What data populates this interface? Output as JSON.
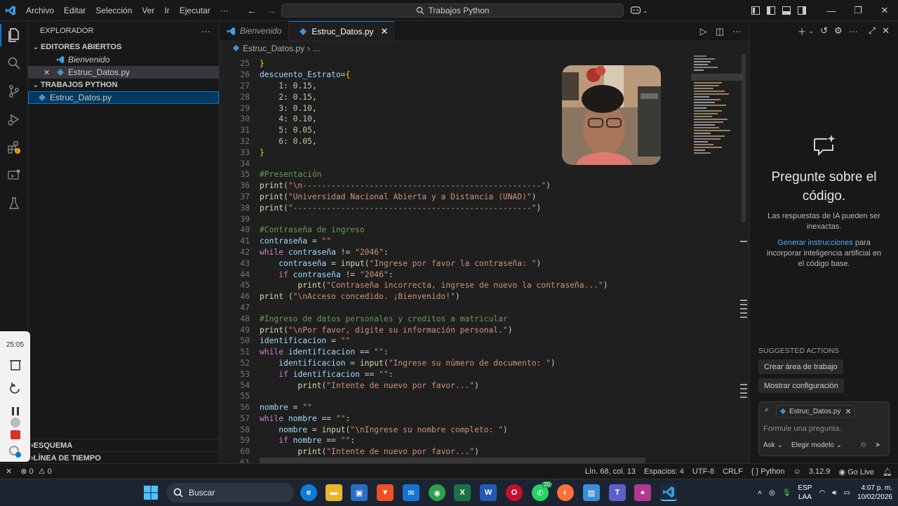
{
  "menu": [
    "Archivo",
    "Editar",
    "Selección",
    "Ver",
    "Ir",
    "Ejecutar",
    "···"
  ],
  "command_center": "Trabajos Python",
  "explorer": {
    "title": "EXPLORADOR",
    "open_editors_label": "EDITORES ABIERTOS",
    "open_editors": [
      "Bienvenido",
      "Estruc_Datos.py"
    ],
    "folder_label": "TRABAJOS PYTHON",
    "files": [
      "Estruc_Datos.py"
    ],
    "outline_label": "ESQUEMA",
    "timeline_label": "LÍNEA DE TIEMPO"
  },
  "tabs": [
    {
      "label": "Bienvenido",
      "active": false
    },
    {
      "label": "Estruc_Datos.py",
      "active": true
    }
  ],
  "breadcrumb": {
    "file": "Estruc_Datos.py",
    "rest": "..."
  },
  "code_lines": [
    {
      "n": "25",
      "html": "<span class=\"br\">}</span>"
    },
    {
      "n": "26",
      "html": "<span class=\"vr\">descuento_Estrato</span>=<span class=\"br\">{</span>"
    },
    {
      "n": "27",
      "html": "    <span class=\"nu\">1</span>: <span class=\"nu\">0.15</span>,"
    },
    {
      "n": "28",
      "html": "    <span class=\"nu\">2</span>: <span class=\"nu\">0.15</span>,"
    },
    {
      "n": "29",
      "html": "    <span class=\"nu\">3</span>: <span class=\"nu\">0.10</span>,"
    },
    {
      "n": "30",
      "html": "    <span class=\"nu\">4</span>: <span class=\"nu\">0.10</span>,"
    },
    {
      "n": "31",
      "html": "    <span class=\"nu\">5</span>: <span class=\"nu\">0.05</span>,"
    },
    {
      "n": "32",
      "html": "    <span class=\"nu\">6</span>: <span class=\"nu\">0.05</span>,"
    },
    {
      "n": "33",
      "html": "<span class=\"br\">}</span>"
    },
    {
      "n": "34",
      "html": ""
    },
    {
      "n": "35",
      "html": "<span class=\"cm\">#Presentación</span>"
    },
    {
      "n": "36",
      "html": "<span class=\"fn\">print</span>(<span class=\"st\">\"\\n--------------------------------------------------\"</span>)"
    },
    {
      "n": "37",
      "html": "<span class=\"fn\">print</span>(<span class=\"st\">\"Universidad Nacional Abierta y a Distancia (UNAD)\"</span>)"
    },
    {
      "n": "38",
      "html": "<span class=\"fn\">print</span>(<span class=\"st\">\"--------------------------------------------------\"</span>)"
    },
    {
      "n": "39",
      "html": ""
    },
    {
      "n": "40",
      "html": "<span class=\"cm\">#Contraseña de ingreso</span>"
    },
    {
      "n": "41",
      "html": "<span class=\"vr\">contraseña</span> = <span class=\"st\">\"\"</span>"
    },
    {
      "n": "42",
      "html": "<span class=\"kw\">while</span> <span class=\"vr\">contraseña</span> != <span class=\"st\">\"2046\"</span>:"
    },
    {
      "n": "43",
      "html": "    <span class=\"vr\">contraseña</span> = <span class=\"fn\">input</span>(<span class=\"st\">\"Ingrese por favor la contraseña: \"</span>)"
    },
    {
      "n": "44",
      "html": "    <span class=\"kw\">if</span> <span class=\"vr\">contraseña</span> != <span class=\"st\">\"2046\"</span>:"
    },
    {
      "n": "45",
      "html": "        <span class=\"fn\">print</span>(<span class=\"st\">\"Contraseña incorrecta, ingrese de nuevo la contraseña...\"</span>)"
    },
    {
      "n": "46",
      "html": "<span class=\"fn\">print</span> (<span class=\"st\">\"\\nAcceso concedido. ¡Bienvenido!\"</span>)"
    },
    {
      "n": "47",
      "html": ""
    },
    {
      "n": "48",
      "html": "<span class=\"cm\">#Ingreso de datos personales y creditos a matricular</span>"
    },
    {
      "n": "49",
      "html": "<span class=\"fn\">print</span>(<span class=\"st\">\"\\nPor favor, digite su información personal.\"</span>)"
    },
    {
      "n": "50",
      "html": "<span class=\"vr\">identificacion</span> = <span class=\"st\">\"\"</span>"
    },
    {
      "n": "51",
      "html": "<span class=\"kw\">while</span> <span class=\"vr\">identificacion</span> == <span class=\"st\">\"\"</span>:"
    },
    {
      "n": "52",
      "html": "    <span class=\"vr\">identificacion</span> = <span class=\"fn\">input</span>(<span class=\"st\">\"Ingrese su número de documento: \"</span>)"
    },
    {
      "n": "53",
      "html": "    <span class=\"kw\">if</span> <span class=\"vr\">identificacion</span> == <span class=\"st\">\"\"</span>:"
    },
    {
      "n": "54",
      "html": "        <span class=\"fn\">print</span>(<span class=\"st\">\"Intente de nuevo por favor...\"</span>)"
    },
    {
      "n": "55",
      "html": ""
    },
    {
      "n": "56",
      "html": "<span class=\"vr\">nombre</span> = <span class=\"st\">\"\"</span>"
    },
    {
      "n": "57",
      "html": "<span class=\"kw\">while</span> <span class=\"vr\">nombre</span> == <span class=\"st\">\"\"</span>:"
    },
    {
      "n": "58",
      "html": "    <span class=\"vr\">nombre</span> = <span class=\"fn\">input</span>(<span class=\"st\">\"\\nIngrese su nombre completo: \"</span>)"
    },
    {
      "n": "59",
      "html": "    <span class=\"kw\">if</span> <span class=\"vr\">nombre</span> == <span class=\"st\">\"\"</span>:"
    },
    {
      "n": "60",
      "html": "        <span class=\"fn\">print</span>(<span class=\"st\">\"Intente de nuevo por favor...\"</span>)"
    },
    {
      "n": "61",
      "html": ""
    }
  ],
  "chat": {
    "title": "Pregunte sobre el código.",
    "disclaimer": "Las respuestas de IA pueden ser inexactas.",
    "link": "Generar instrucciones",
    "link_rest": " para incorporar inteligencia artificial en el código base.",
    "suggested_title": "SUGGESTED ACTIONS",
    "actions": [
      "Crear área de trabajo",
      "Mostrar configuración"
    ],
    "attachment": "Estruc_Datos.py",
    "placeholder": "Formule una pregunta.",
    "mode": "Ask",
    "model": "Elegir modelo"
  },
  "status": {
    "errors": "0",
    "warnings": "0",
    "position": "Lín. 68, col. 13",
    "spaces": "Espacios: 4",
    "encoding": "UTF-8",
    "eol": "CRLF",
    "language": "Python",
    "version": "3.12.9",
    "golive": "Go Live"
  },
  "recorder": {
    "time": "25:05"
  },
  "taskbar": {
    "search": "Buscar",
    "lang": "ESP",
    "lang2": "LAA",
    "time": "4:07 p. m.",
    "date": "10/02/2026",
    "whatsapp_badge": "20"
  },
  "colors": {
    "accent": "#0078d4",
    "editor_bg": "#1f1f1f",
    "chrome_bg": "#181818"
  }
}
